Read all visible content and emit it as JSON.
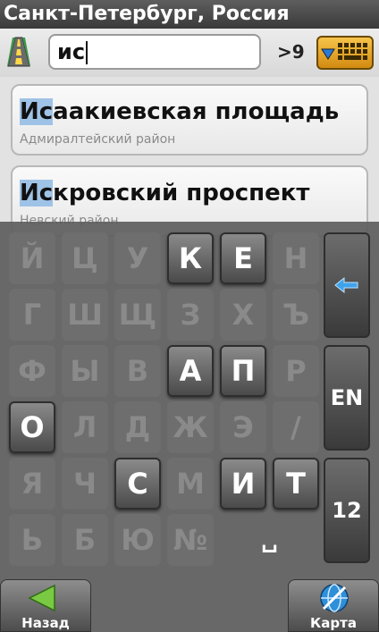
{
  "header": {
    "title": "Санкт-Петербург, Россия"
  },
  "search": {
    "value": "ис",
    "result_count": ">9"
  },
  "results": [
    {
      "highlight": "Ис",
      "rest": "аакиевская площадь",
      "district": "Адмиралтейский район"
    },
    {
      "highlight": "Ис",
      "rest": "кровский проспект",
      "district": "Невский район"
    }
  ],
  "keyboard": {
    "rows": [
      [
        {
          "label": "Й",
          "on": false
        },
        {
          "label": "Ц",
          "on": false
        },
        {
          "label": "У",
          "on": false
        },
        {
          "label": "К",
          "on": true
        },
        {
          "label": "Е",
          "on": true
        },
        {
          "label": "Н",
          "on": false
        }
      ],
      [
        {
          "label": "Г",
          "on": false
        },
        {
          "label": "Ш",
          "on": false
        },
        {
          "label": "Щ",
          "on": false
        },
        {
          "label": "З",
          "on": false
        },
        {
          "label": "Х",
          "on": false
        },
        {
          "label": "Ъ",
          "on": false
        }
      ],
      [
        {
          "label": "Ф",
          "on": false
        },
        {
          "label": "Ы",
          "on": false
        },
        {
          "label": "В",
          "on": false
        },
        {
          "label": "А",
          "on": true
        },
        {
          "label": "П",
          "on": true
        },
        {
          "label": "Р",
          "on": false
        }
      ],
      [
        {
          "label": "О",
          "on": true
        },
        {
          "label": "Л",
          "on": false
        },
        {
          "label": "Д",
          "on": false
        },
        {
          "label": "Ж",
          "on": false
        },
        {
          "label": "Э",
          "on": false
        },
        {
          "label": "/",
          "on": false
        }
      ],
      [
        {
          "label": "Я",
          "on": false
        },
        {
          "label": "Ч",
          "on": false
        },
        {
          "label": "С",
          "on": true
        },
        {
          "label": "М",
          "on": false
        },
        {
          "label": "И",
          "on": true
        },
        {
          "label": "Т",
          "on": true
        }
      ],
      [
        {
          "label": "Ь",
          "on": false
        },
        {
          "label": "Б",
          "on": false
        },
        {
          "label": "Ю",
          "on": false
        },
        {
          "label": "№",
          "on": false
        },
        {
          "label": "␣",
          "on": true,
          "name": "space"
        }
      ]
    ],
    "lang_label": "EN",
    "numbers_label": "12"
  },
  "nav": {
    "back_label": "Назад",
    "map_label": "Карта"
  },
  "colors": {
    "highlight": "#9fc3e6",
    "key_toggle": "#f0b030",
    "back_arrow": "#7ac943",
    "map_globe": "#2f8fd8"
  }
}
